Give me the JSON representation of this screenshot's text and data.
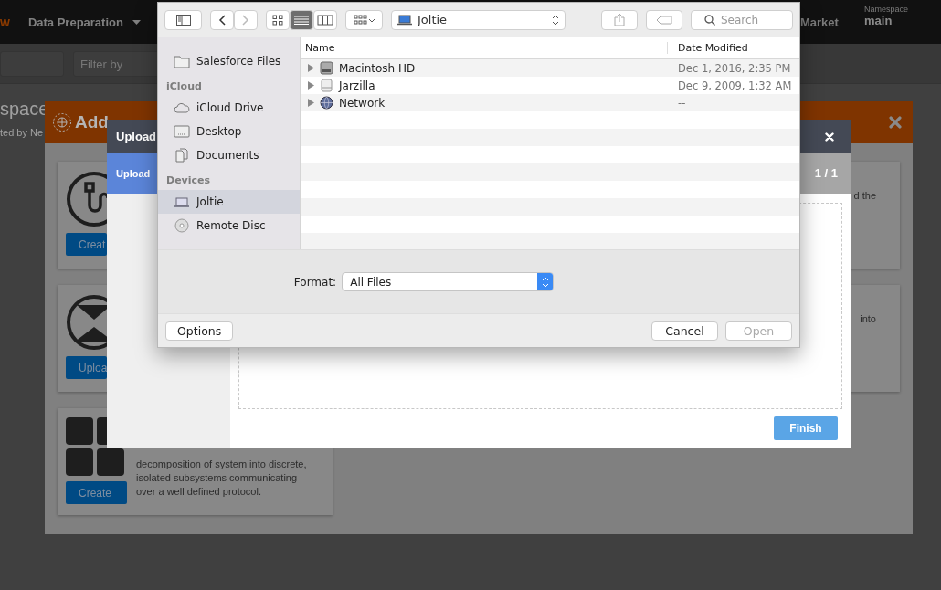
{
  "nav_bar": {
    "brand_fragment": "w",
    "menu": "Data Preparation",
    "market": "Market",
    "namespace_label": "Namespace",
    "namespace": "main"
  },
  "filter_bar": {
    "filter_placeholder": "Filter by"
  },
  "page": {
    "title": "space",
    "subtitle": "ted by Ne"
  },
  "add_entity_dialog": {
    "title": "Add",
    "cards": [
      {
        "kind": "pipeline",
        "button": "Creat"
      },
      {
        "kind": "upload",
        "button": "Uploa"
      },
      {
        "kind": "grid",
        "button": "Create",
        "description": "decomposition of system into discrete, isolated subsystems communicating over a well defined protocol."
      }
    ],
    "right_texts": [
      "d the",
      "into"
    ]
  },
  "upload_dialog": {
    "title": "Upload",
    "steps": [
      {
        "label": "Upload",
        "selected": true
      }
    ],
    "step_count": "1 / 1",
    "finish": "Finish"
  },
  "open_dialog": {
    "view_modes": [
      {
        "kind": "icons",
        "selected": false
      },
      {
        "kind": "list",
        "selected": true
      },
      {
        "kind": "columns",
        "selected": false
      }
    ],
    "location": "Joltie",
    "search_placeholder": "Search",
    "sidebar": [
      {
        "items": [
          {
            "label": "Salesforce Files",
            "kind": "folder",
            "selected": false
          }
        ]
      },
      {
        "header": "iCloud",
        "items": [
          {
            "label": "iCloud Drive",
            "kind": "cloud",
            "selected": false
          },
          {
            "label": "Desktop",
            "kind": "desktop",
            "selected": false
          },
          {
            "label": "Documents",
            "kind": "documents",
            "selected": false
          }
        ]
      },
      {
        "header": "Devices",
        "items": [
          {
            "label": "Joltie",
            "kind": "laptop",
            "selected": true
          },
          {
            "label": "Remote Disc",
            "kind": "disc",
            "selected": false
          }
        ]
      }
    ],
    "columns": [
      "Name",
      "Date Modified"
    ],
    "rows": [
      {
        "name": "Macintosh HD",
        "kind": "disk",
        "date": "Dec 1, 2016, 2:35 PM"
      },
      {
        "name": "Jarzilla",
        "kind": "drive",
        "date": "Dec 9, 2009, 1:32 AM"
      },
      {
        "name": "Network",
        "kind": "network",
        "date": "--"
      }
    ],
    "format_label": "Format:",
    "format": "All Files",
    "buttons": [
      {
        "label": "Options",
        "kind": "left",
        "disabled": false
      },
      {
        "label": "Cancel",
        "kind": "right",
        "disabled": false
      },
      {
        "label": "Open",
        "kind": "right",
        "disabled": true
      }
    ]
  }
}
